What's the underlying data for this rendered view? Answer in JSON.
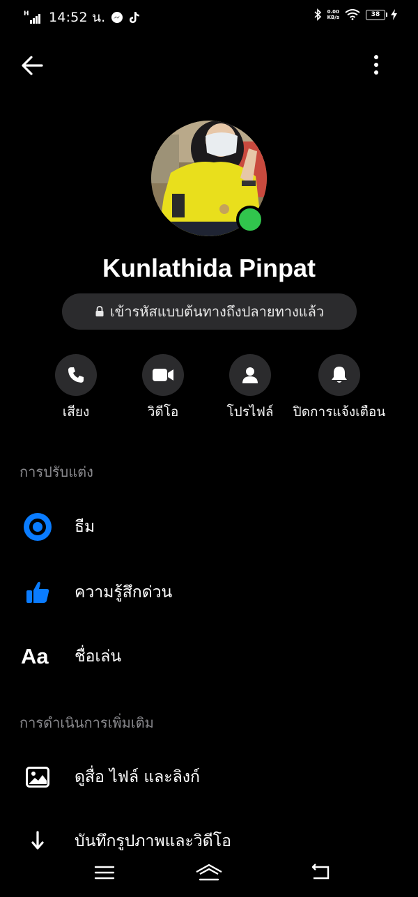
{
  "status_bar": {
    "network": "H",
    "time": "14:52 น.",
    "speed_value": "0.00",
    "speed_unit": "KB/s",
    "battery": "38"
  },
  "header": {
    "back_icon": "arrow-left-icon",
    "menu_icon": "more-vertical-icon"
  },
  "profile": {
    "name": "Kunlathida Pinpat",
    "online": true,
    "encryption_text": "เข้ารหัสแบบต้นทางถึงปลายทางแล้ว"
  },
  "actions": [
    {
      "label": "เสียง",
      "icon": "phone-icon"
    },
    {
      "label": "วิดีโอ",
      "icon": "video-camera-icon"
    },
    {
      "label": "โปรไฟล์",
      "icon": "person-icon"
    },
    {
      "label": "ปิดการแจ้งเตือน",
      "icon": "bell-icon"
    }
  ],
  "customize": {
    "title": "การปรับแต่ง",
    "items": [
      {
        "label": "ธีม",
        "icon": "theme-icon"
      },
      {
        "label": "ความรู้สึกด่วน",
        "icon": "thumbs-up-icon"
      },
      {
        "label": "ชื่อเล่น",
        "icon": "Aa"
      }
    ]
  },
  "more_actions": {
    "title": "การดำเนินการเพิ่มเติม",
    "items": [
      {
        "label": "ดูสื่อ ไฟล์ และลิงก์",
        "icon": "image-icon"
      },
      {
        "label": "บันทึกรูปภาพและวิดีโอ",
        "icon": "download-arrow-icon"
      }
    ]
  },
  "colors": {
    "accent": "#0a7cff",
    "online": "#31c54d",
    "button_bg": "#2b2b2d"
  }
}
